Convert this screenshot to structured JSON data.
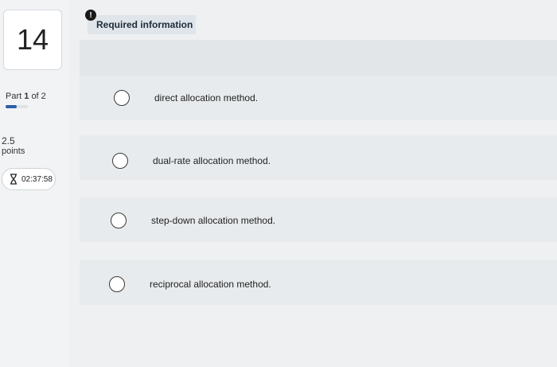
{
  "sidebar": {
    "question_number": "14",
    "part_prefix": "Part",
    "part_current": "1",
    "part_suffix": "of 2",
    "part_progress_fraction": 0.5,
    "points_value": "2.5",
    "points_label": "points",
    "timer": "02:37:58",
    "timer_icon": "hourglass-icon"
  },
  "main": {
    "alert_icon_text": "!",
    "required_label": "Required information",
    "options": [
      {
        "label": "direct allocation method."
      },
      {
        "label": "dual-rate allocation method."
      },
      {
        "label": "step-down allocation method."
      },
      {
        "label": "reciprocal allocation method."
      }
    ]
  },
  "colors": {
    "progress_fill": "#2b5fa8",
    "banner_bg": "#dfe5ea"
  }
}
